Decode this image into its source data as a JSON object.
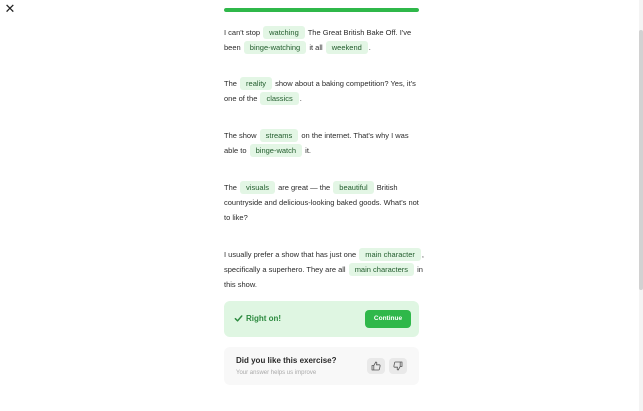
{
  "window": {
    "close_symbol": "✕"
  },
  "progress": {
    "fraction": 1.0,
    "color": "#2fb84a"
  },
  "exercise": {
    "p1": {
      "t1": "I can't stop",
      "c1": "watching",
      "t2": "The Great British Bake Off.",
      "t3": "I've been",
      "c2": "binge-watching",
      "t4": "it all",
      "c3": "weekend",
      "t5": "."
    },
    "p2": {
      "t1": "The",
      "c1": "reality",
      "t2": "show about a baking competition? Yes, it's one of the",
      "c2": "classics",
      "t3": "."
    },
    "p3": {
      "t1": "The show",
      "c1": "streams",
      "t2": "on the internet. That's why I was able to",
      "c2": "binge-watch",
      "t3": "it."
    },
    "p4": {
      "t1": "The",
      "c1": "visuals",
      "t2": "are great — the",
      "c2": "beautiful",
      "t3": "British countryside and delicious-looking baked goods. What's not to like?"
    },
    "p5": {
      "t1": "I usually prefer a show that has just one",
      "c1": "main character",
      "t2": ", specifically a superhero. They are all",
      "c2": "main characters",
      "t3": "in this show."
    }
  },
  "feedback": {
    "status_icon": "check-icon",
    "message": "Right on!",
    "continue_label": "Continue",
    "accent": "#2fb84a"
  },
  "rating": {
    "title": "Did you like this exercise?",
    "subtitle": "Your answer helps us improve",
    "like_icon": "thumbs-up-icon",
    "dislike_icon": "thumbs-down-icon"
  }
}
